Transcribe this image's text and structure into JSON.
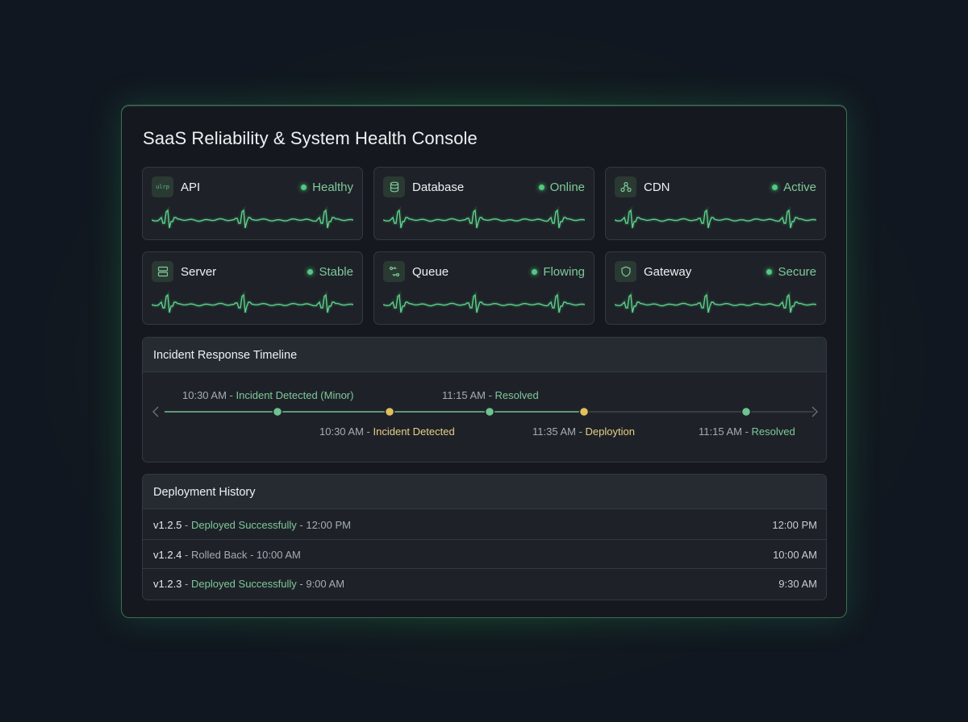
{
  "title": "SaaS Reliability & System Health Console",
  "colors": {
    "accent": "#4fcb7e",
    "status_text": "#7fc99b",
    "warning": "#e0c05c"
  },
  "services": [
    {
      "name": "API",
      "status": "Healthy",
      "icon": "api-code-icon",
      "icon_text": "ulrp"
    },
    {
      "name": "Database",
      "status": "Online",
      "icon": "database-icon"
    },
    {
      "name": "CDN",
      "status": "Active",
      "icon": "network-nodes-icon"
    },
    {
      "name": "Server",
      "status": "Stable",
      "icon": "server-icon"
    },
    {
      "name": "Queue",
      "status": "Flowing",
      "icon": "queue-flow-icon"
    },
    {
      "name": "Gateway",
      "status": "Secure",
      "icon": "shield-icon"
    }
  ],
  "timeline": {
    "header": "Incident Response Timeline",
    "top_events": [
      {
        "time": "10:30 AM",
        "label": "Incident Detected (Minor)"
      },
      {
        "time": "11:15 AM",
        "label": "Resolved"
      }
    ],
    "bottom_events": [
      {
        "time": "10:30 AM",
        "label": "Incident Detected"
      },
      {
        "time": "11:35 AM",
        "label": "Deploytion"
      },
      {
        "time": "11:15 AM",
        "label": "Resolved"
      }
    ],
    "separator": " - "
  },
  "deployments": {
    "header": "Deployment History",
    "rows": [
      {
        "version": "v1.2.5",
        "action": "Deployed Successfully",
        "action_time": "12:00 PM",
        "time": "12:00 PM"
      },
      {
        "version": "v1.2.4",
        "action": "Rolled Back",
        "action_time": "10:00 AM",
        "time": "10:00 AM"
      },
      {
        "version": "v1.2.3",
        "action": "Deployed Successfully",
        "action_time": "9:00 AM",
        "time": "9:30 AM"
      }
    ],
    "separator": " - "
  }
}
